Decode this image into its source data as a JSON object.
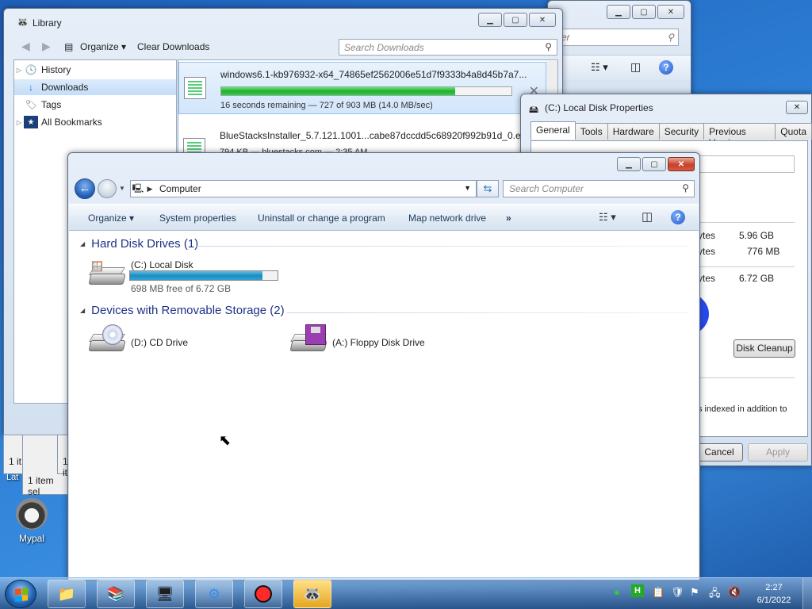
{
  "background_window": {
    "search_placeholder": "er",
    "icons": [
      "views-icon",
      "preview-pane-icon",
      "help-icon"
    ]
  },
  "library": {
    "title": "Library",
    "toolbar": {
      "organize": "Organize",
      "clear": "Clear Downloads"
    },
    "search_placeholder": "Search Downloads",
    "sidebar": [
      {
        "label": "History",
        "icon": "history-clock-icon"
      },
      {
        "label": "Downloads",
        "icon": "downloads-arrow-icon",
        "selected": true
      },
      {
        "label": "Tags",
        "icon": "tag-icon"
      },
      {
        "label": "All Bookmarks",
        "icon": "bookmarks-star-icon"
      }
    ],
    "downloads": [
      {
        "name": "windows6.1-kb976932-x64_74865ef2562006e51d7f9333b4a8d45b7a7...",
        "progress": 0.805,
        "status": "16 seconds remaining — 727 of 903 MB (14.0 MB/sec)"
      },
      {
        "name": "BlueStacksInstaller_5.7.121.1001...cabe87dccdd5c68920f992b91d_0.exe",
        "status": "794 KB — bluestacks.com — 2:35 AM"
      }
    ],
    "status_fragments": [
      "1 it",
      "1 item sel",
      "1 it"
    ]
  },
  "props": {
    "title": "(C:) Local Disk Properties",
    "tabs": [
      "General",
      "Tools",
      "Hardware",
      "Security",
      "Previous Versions",
      "Quota"
    ],
    "used_label": "ytes",
    "used_value": "5.96 GB",
    "free_label": "ytes",
    "free_value": "776 MB",
    "cap_label": "ytes",
    "cap_value": "6.72 GB",
    "disk_cleanup": "Disk Cleanup",
    "indexed_text": "s indexed in addition to",
    "cancel": "Cancel",
    "apply": "Apply",
    "pie_color": "#1a3ae8"
  },
  "computer": {
    "address": "Computer",
    "search_placeholder": "Search Computer",
    "commands": [
      "Organize",
      "System properties",
      "Uninstall or change a program",
      "Map network drive"
    ],
    "groups": {
      "hdd": "Hard Disk Drives (1)",
      "removable": "Devices with Removable Storage (2)"
    },
    "drives": {
      "c": {
        "label": "(C:) Local Disk",
        "free": "698 MB free of 6.72 GB",
        "used_fraction": 0.898
      },
      "d": {
        "label": "(D:) CD Drive"
      },
      "a": {
        "label": "(A:) Floppy Disk Drive"
      }
    }
  },
  "desktop": {
    "icon_label": "Mypal",
    "partial_label": "Lat"
  },
  "taskbar": {
    "apps": [
      "explorer-icon",
      "winrar-icon",
      "control-panel-icon",
      "settings-gears-icon",
      "record-icon",
      "mypal-icon"
    ],
    "time": "2:27",
    "date": "6/1/2022"
  }
}
